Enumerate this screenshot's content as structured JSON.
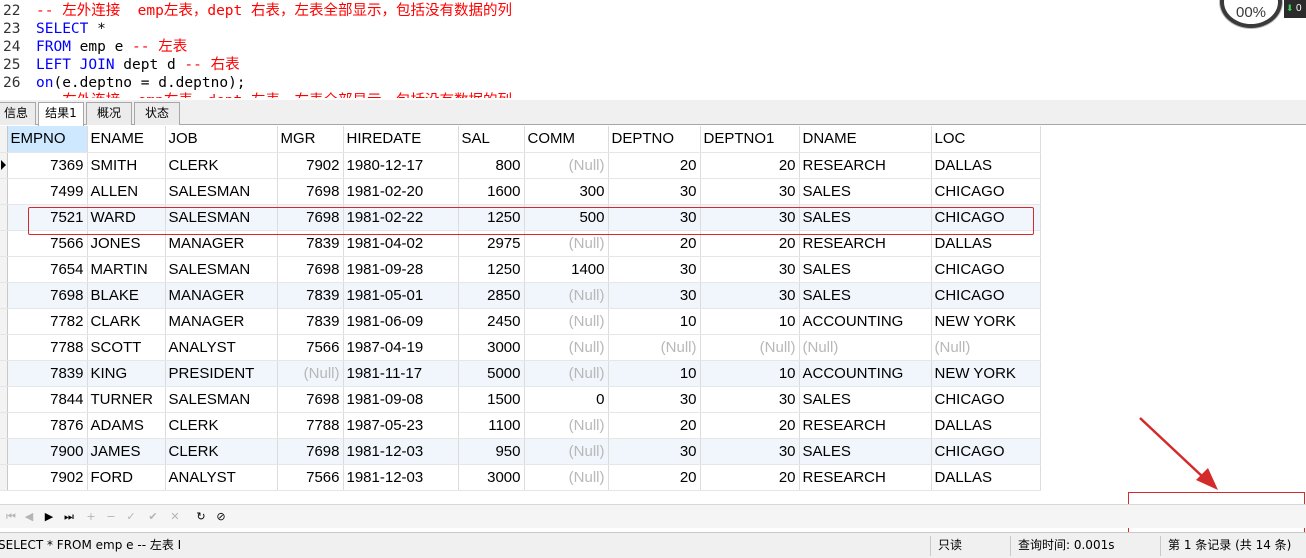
{
  "editor": {
    "lines": [
      {
        "num": "22",
        "tokens": [
          {
            "t": "cm",
            "v": "-- 左外连接  emp左表，dept 右表，左表全部显示，包括没有数据的列"
          }
        ]
      },
      {
        "num": "23",
        "tokens": [
          {
            "t": "kw",
            "v": "SELECT"
          },
          {
            "t": "tx",
            "v": " *"
          }
        ]
      },
      {
        "num": "24",
        "tokens": [
          {
            "t": "kw",
            "v": "FROM"
          },
          {
            "t": "tx",
            "v": " emp e "
          },
          {
            "t": "cm",
            "v": "-- 左表"
          }
        ]
      },
      {
        "num": "25",
        "tokens": [
          {
            "t": "kw",
            "v": "LEFT JOIN"
          },
          {
            "t": "tx",
            "v": " dept d "
          },
          {
            "t": "cm",
            "v": "-- 右表"
          }
        ]
      },
      {
        "num": "26",
        "tokens": [
          {
            "t": "kw",
            "v": "on"
          },
          {
            "t": "tx",
            "v": "(e.deptno = d.deptno);"
          }
        ]
      },
      {
        "num": "",
        "tokens": [
          {
            "t": "cm",
            "v": "-- 右外连接  emp右表，dept 左表，右表全部显示，包括没有数据的列"
          }
        ]
      }
    ],
    "gauge_text": "00%",
    "net_text": "0"
  },
  "tabs": [
    "信息",
    "结果1",
    "概况",
    "状态"
  ],
  "active_tab": 1,
  "grid": {
    "columns": [
      "EMPNO",
      "ENAME",
      "JOB",
      "MGR",
      "HIREDATE",
      "SAL",
      "COMM",
      "DEPTNO",
      "DEPTNO1",
      "DNAME",
      "LOC"
    ],
    "null_text": "(Null)",
    "rows": [
      [
        "7369",
        "SMITH",
        "CLERK",
        "7902",
        "1980-12-17",
        "800",
        null,
        "20",
        "20",
        "RESEARCH",
        "DALLAS"
      ],
      [
        "7499",
        "ALLEN",
        "SALESMAN",
        "7698",
        "1981-02-20",
        "1600",
        "300",
        "30",
        "30",
        "SALES",
        "CHICAGO"
      ],
      [
        "7521",
        "WARD",
        "SALESMAN",
        "7698",
        "1981-02-22",
        "1250",
        "500",
        "30",
        "30",
        "SALES",
        "CHICAGO"
      ],
      [
        "7566",
        "JONES",
        "MANAGER",
        "7839",
        "1981-04-02",
        "2975",
        null,
        "20",
        "20",
        "RESEARCH",
        "DALLAS"
      ],
      [
        "7654",
        "MARTIN",
        "SALESMAN",
        "7698",
        "1981-09-28",
        "1250",
        "1400",
        "30",
        "30",
        "SALES",
        "CHICAGO"
      ],
      [
        "7698",
        "BLAKE",
        "MANAGER",
        "7839",
        "1981-05-01",
        "2850",
        null,
        "30",
        "30",
        "SALES",
        "CHICAGO"
      ],
      [
        "7782",
        "CLARK",
        "MANAGER",
        "7839",
        "1981-06-09",
        "2450",
        null,
        "10",
        "10",
        "ACCOUNTING",
        "NEW YORK"
      ],
      [
        "7788",
        "SCOTT",
        "ANALYST",
        "7566",
        "1987-04-19",
        "3000",
        null,
        null,
        null,
        null,
        null
      ],
      [
        "7839",
        "KING",
        "PRESIDENT",
        null,
        "1981-11-17",
        "5000",
        null,
        "10",
        "10",
        "ACCOUNTING",
        "NEW YORK"
      ],
      [
        "7844",
        "TURNER",
        "SALESMAN",
        "7698",
        "1981-09-08",
        "1500",
        "0",
        "30",
        "30",
        "SALES",
        "CHICAGO"
      ],
      [
        "7876",
        "ADAMS",
        "CLERK",
        "7788",
        "1987-05-23",
        "1100",
        null,
        "20",
        "20",
        "RESEARCH",
        "DALLAS"
      ],
      [
        "7900",
        "JAMES",
        "CLERK",
        "7698",
        "1981-12-03",
        "950",
        null,
        "30",
        "30",
        "SALES",
        "CHICAGO"
      ],
      [
        "7902",
        "FORD",
        "ANALYST",
        "7566",
        "1981-12-03",
        "3000",
        null,
        "20",
        "20",
        "RESEARCH",
        "DALLAS"
      ]
    ]
  },
  "nav_buttons": [
    {
      "name": "first-record-icon",
      "glyph": "⏮",
      "enabled": false
    },
    {
      "name": "prev-record-icon",
      "glyph": "◀",
      "enabled": false
    },
    {
      "name": "next-record-icon",
      "glyph": "▶",
      "enabled": true
    },
    {
      "name": "last-record-icon",
      "glyph": "⏭",
      "enabled": true
    },
    {
      "name": "add-record-icon",
      "glyph": "+",
      "enabled": false
    },
    {
      "name": "delete-record-icon",
      "glyph": "−",
      "enabled": false
    },
    {
      "name": "edit-record-icon",
      "glyph": "✓",
      "enabled": false
    },
    {
      "name": "apply-changes-icon",
      "glyph": "✔",
      "enabled": false
    },
    {
      "name": "discard-changes-icon",
      "glyph": "✕",
      "enabled": false
    },
    {
      "name": "refresh-icon",
      "glyph": "↻",
      "enabled": true
    },
    {
      "name": "stop-icon",
      "glyph": "⊘",
      "enabled": true
    }
  ],
  "statusbar": {
    "sql": "SELECT * FROM emp e -- 左表 I",
    "readonly": "只读",
    "query_time": "查询时间: 0.001s",
    "record": "第 1 条记录 (共 14 条)"
  },
  "colors": {
    "annotation": "#d42a2a",
    "keyword": "#0000ff",
    "comment": "#ff0000",
    "header_selected": "#cde8ff"
  }
}
